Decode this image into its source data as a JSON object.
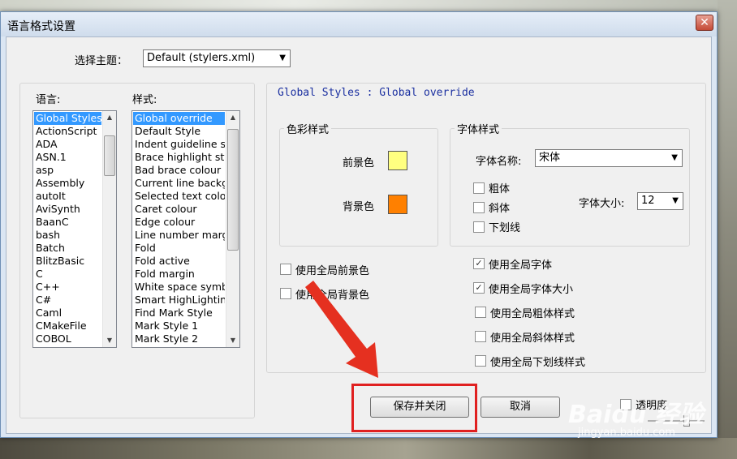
{
  "window": {
    "title": "语言格式设置",
    "close_glyph": "✕"
  },
  "theme": {
    "label": "选择主题：",
    "value": "Default (stylers.xml)"
  },
  "language": {
    "label": "语言:",
    "items": [
      "Global Styles",
      "ActionScript",
      "ADA",
      "ASN.1",
      "asp",
      "Assembly",
      "autoIt",
      "AviSynth",
      "BaanC",
      "bash",
      "Batch",
      "BlitzBasic",
      "C",
      "C++",
      "C#",
      "Caml",
      "CMakeFile",
      "COBOL"
    ],
    "selected_index": 0
  },
  "style": {
    "label": "样式:",
    "items": [
      "Global override",
      "Default Style",
      "Indent guideline st",
      "Brace highlight styl",
      "Bad brace colour",
      "Current line backgr",
      "Selected text colou",
      "Caret colour",
      "Edge colour",
      "Line number marg",
      "Fold",
      "Fold active",
      "Fold margin",
      "White space symbo",
      "Smart HighLighting",
      "Find Mark Style",
      "Mark Style 1",
      "Mark Style 2"
    ],
    "selected_index": 0
  },
  "header_text": "Global Styles : Global override",
  "color_group": {
    "title": "色彩样式",
    "foreground_label": "前景色",
    "background_label": "背景色",
    "foreground_color": "#ffff80",
    "background_color": "#ff8000"
  },
  "font_group": {
    "title": "字体样式",
    "name_label": "字体名称:",
    "name_value": "宋体",
    "bold_label": "粗体",
    "italic_label": "斜体",
    "underline_label": "下划线",
    "size_label": "字体大小:",
    "size_value": "12"
  },
  "global_options": {
    "fg": {
      "label": "使用全局前景色",
      "checked": false
    },
    "bg": {
      "label": "使用全局背景色",
      "checked": false
    },
    "font": {
      "label": "使用全局字体",
      "checked": true
    },
    "font_size": {
      "label": "使用全局字体大小",
      "checked": true
    },
    "bold": {
      "label": "使用全局粗体样式",
      "checked": false
    },
    "italic": {
      "label": "使用全局斜体样式",
      "checked": false
    },
    "underline": {
      "label": "使用全局下划线样式",
      "checked": false
    }
  },
  "buttons": {
    "save_close": "保存并关闭",
    "cancel": "取消"
  },
  "transparency": {
    "label": "透明度",
    "checked": false
  },
  "icons": {
    "dropdown": "▼",
    "scroll_up": "▲",
    "scroll_down": "▼",
    "grip": "≡",
    "check": "✓"
  },
  "annotation": {
    "highlight_color": "#e02020",
    "arrow_color": "#e53020"
  },
  "watermark": {
    "brand": "Baidu 经验",
    "url": "jingyan.baidu.com"
  }
}
